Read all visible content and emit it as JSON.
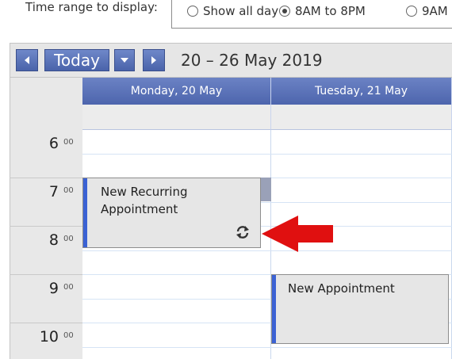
{
  "options": {
    "label": "Time range to display:",
    "choices": [
      {
        "label": "Show all day",
        "checked": false
      },
      {
        "label": "8AM to 8PM",
        "checked": true
      },
      {
        "label": "9AM",
        "checked": false
      }
    ]
  },
  "toolbar": {
    "today_label": "Today",
    "date_range": "20 – 26 May 2019",
    "prev_icon": "chevron-left-icon",
    "next_icon": "chevron-right-icon",
    "dropdown_icon": "caret-down-icon"
  },
  "days": [
    {
      "label": "Monday, 20 May"
    },
    {
      "label": "Tuesday, 21 May"
    }
  ],
  "hours": [
    {
      "hour": "6",
      "minutes": "00"
    },
    {
      "hour": "7",
      "minutes": "00"
    },
    {
      "hour": "8",
      "minutes": "00"
    },
    {
      "hour": "9",
      "minutes": "00"
    },
    {
      "hour": "10",
      "minutes": "00"
    }
  ],
  "appointments": [
    {
      "title": "New Recurring Appointment",
      "recurring": true,
      "icon": "recurrence-icon"
    },
    {
      "title": "New Appointment",
      "recurring": false
    }
  ],
  "annotation": {
    "icon": "red-arrow-icon",
    "color": "#e01010"
  },
  "colors": {
    "header": "#5a72b8",
    "accent_bar": "#3b62d4",
    "appointment_bg": "#e6e6e6"
  }
}
